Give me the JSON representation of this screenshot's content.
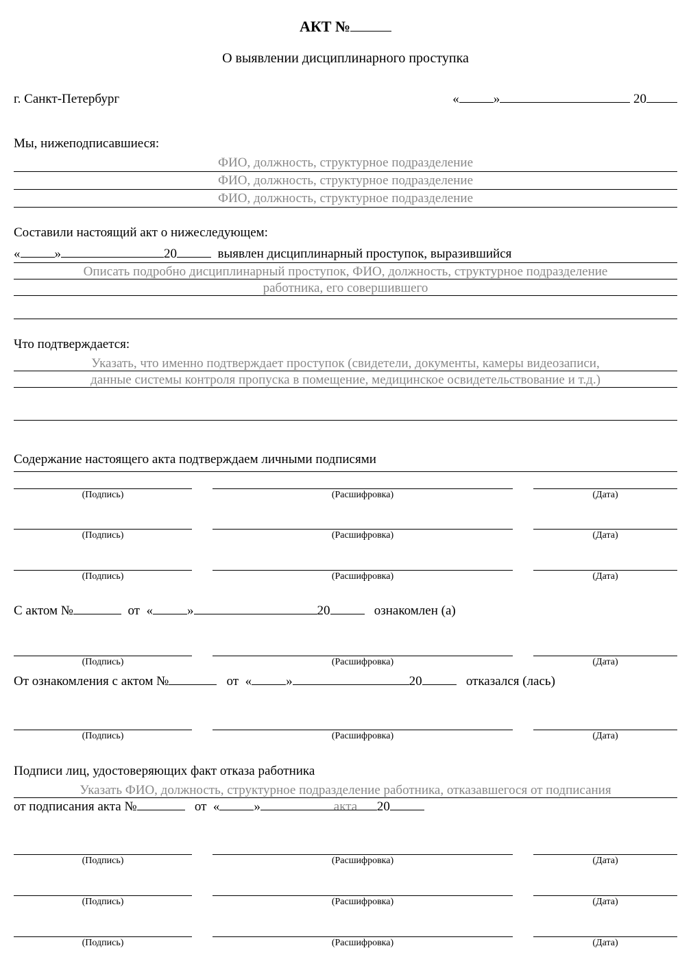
{
  "header": {
    "act_label": "АКТ №",
    "subtitle": "О выявлении дисциплинарного проступка"
  },
  "location_date": {
    "city": "г. Санкт-Петербург",
    "quote_open": "«",
    "quote_close": "»",
    "century": "20"
  },
  "signers_intro": "Мы, нижеподписавшиеся:",
  "signer_hint": "ФИО, должность, структурное подразделение",
  "act_body": {
    "intro": "Составили настоящий акт о нижеследующем:",
    "after_date": "выявлен дисциплинарный проступок, выразившийся",
    "hint_line1": "Описать подробно дисциплинарный проступок, ФИО, должность, структурное подразделение",
    "hint_line2": "работника, его совершившего"
  },
  "confirm": {
    "label": "Что подтверждается:",
    "hint_line1": "Указать, что именно подтверждает проступок (свидетели, документы, камеры видеозаписи,",
    "hint_line2": "данные системы контроля пропуска в помещение, медицинское освидетельствование и т.д.)"
  },
  "sig_block": {
    "heading": "Содержание настоящего акта подтверждаем личными подписями",
    "col_sign": "(Подпись)",
    "col_name": "(Расшифровка)",
    "col_date": "(Дата)"
  },
  "ack": {
    "prefix": "С актом №",
    "from": "от",
    "suffix": "ознакомлен (а)"
  },
  "refuse": {
    "prefix": "От ознакомления с актом №",
    "from": "от",
    "suffix": "отказался (лась)"
  },
  "refuse_witness": {
    "heading": "Подписи лиц, удостоверяющих факт отказа работника",
    "hint_line1": "Указать ФИО, должность, структурное подразделение работника, отказавшегося от подписания",
    "hint_line2": "акта",
    "from_sign_prefix": "от подписания акта №",
    "from": "от"
  }
}
